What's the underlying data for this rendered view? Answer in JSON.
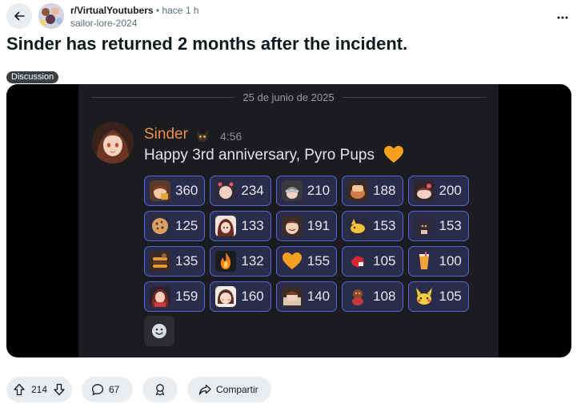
{
  "header": {
    "subreddit": "r/VirtualYoutubers",
    "time": "• hace 1 h",
    "author": "sailor-lore-2024"
  },
  "post": {
    "title": "Sinder has returned 2 months after the incident.",
    "flair": "Discussion"
  },
  "discord": {
    "date": "25 de junio de 2025",
    "name": "Sinder",
    "time": "4:56",
    "text": "Happy 3rd anniversary, Pyro Pups",
    "reactions": [
      [
        {
          "icon": "sinder-peek-emoji",
          "count": "360"
        },
        {
          "icon": "sinder-hearts-emoji",
          "count": "234"
        },
        {
          "icon": "sinder-helmet-emoji",
          "count": "210"
        },
        {
          "icon": "hand-pat-emoji",
          "count": "188"
        },
        {
          "icon": "sinder-lay-emoji",
          "count": "200"
        }
      ],
      [
        {
          "icon": "cookie-emoji",
          "count": "125"
        },
        {
          "icon": "sinder-cute-emoji",
          "count": "133"
        },
        {
          "icon": "sinder-smile-emoji",
          "count": "191"
        },
        {
          "icon": "yellow-pup-emoji",
          "count": "153"
        },
        {
          "icon": "pup-dance-emoji",
          "count": "153"
        }
      ],
      [
        {
          "icon": "pup-burger-emoji",
          "count": "135"
        },
        {
          "icon": "fire-emoji",
          "count": "132"
        },
        {
          "icon": "orange-heart-emoji",
          "count": "155"
        },
        {
          "icon": "red-pup-emoji",
          "count": "105"
        },
        {
          "icon": "orange-drink-emoji",
          "count": "100"
        }
      ],
      [
        {
          "icon": "sinder-wave-emoji",
          "count": "159"
        },
        {
          "icon": "sinder-blush-emoji",
          "count": "160"
        },
        {
          "icon": "sinder-sleep-emoji",
          "count": "140"
        },
        {
          "icon": "pup-sit-emoji",
          "count": "108"
        },
        {
          "icon": "pikachu-emoji",
          "count": "105"
        }
      ]
    ]
  },
  "actions": {
    "upvotes": "214",
    "comments": "67",
    "share": "Compartir"
  },
  "colors": {
    "accent_name": "#f38b4a",
    "reaction_border": "#5665d8",
    "reaction_bg": "#292c4a",
    "discord_bg": "#1b1c20"
  }
}
